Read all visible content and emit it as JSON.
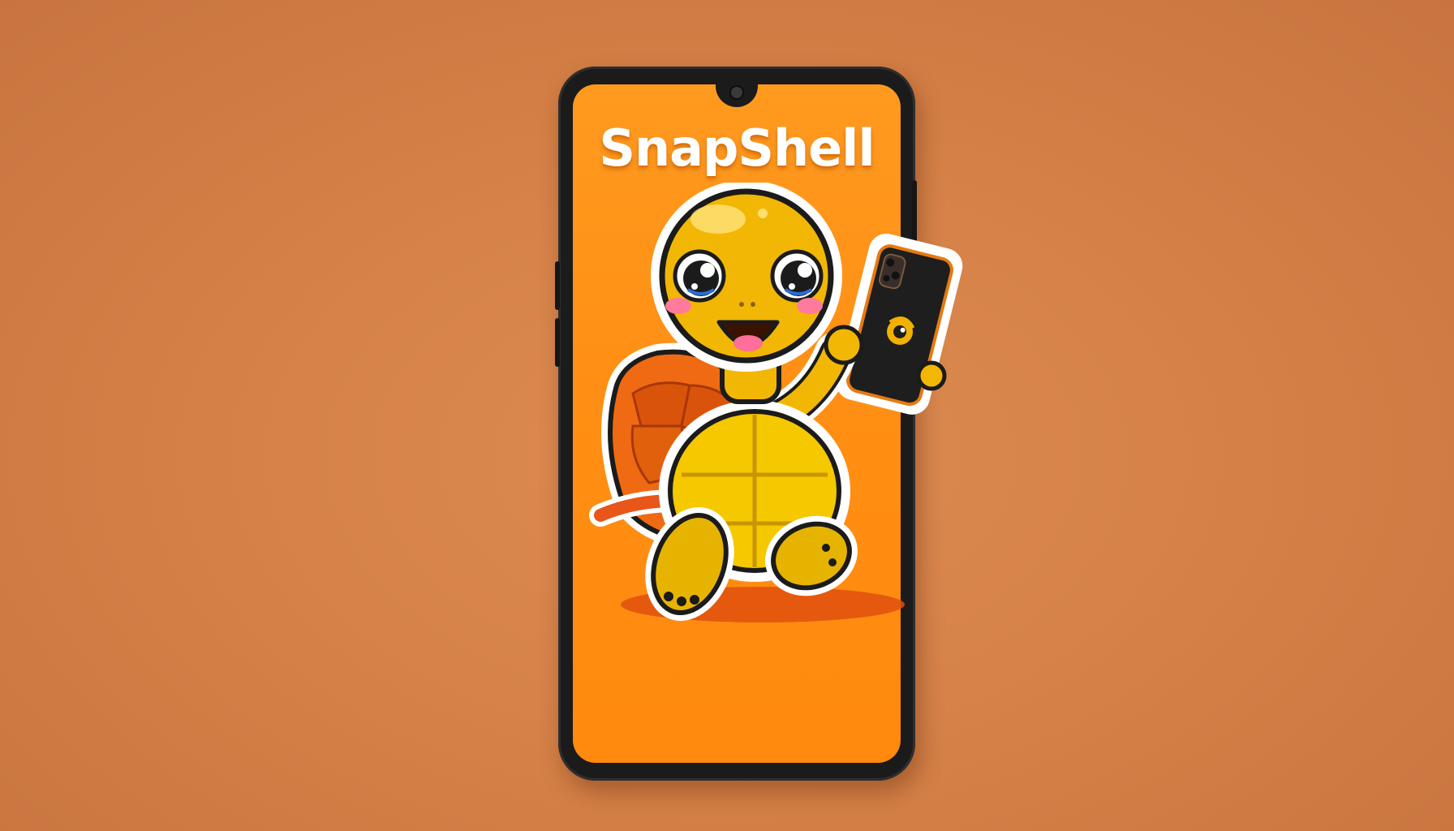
{
  "app": {
    "title": "SnapShell"
  },
  "colors": {
    "background": "#d4834a",
    "screen": "#ff9318",
    "phone_frame": "#1b1b1b",
    "title": "#ffffff",
    "turtle_body": "#f2b705",
    "shell": "#ef6a12"
  },
  "icons": {
    "front_camera": "camera-lens-icon",
    "mascot": "turtle-mascot-icon",
    "app_logo": "snapshell-logo-icon"
  }
}
